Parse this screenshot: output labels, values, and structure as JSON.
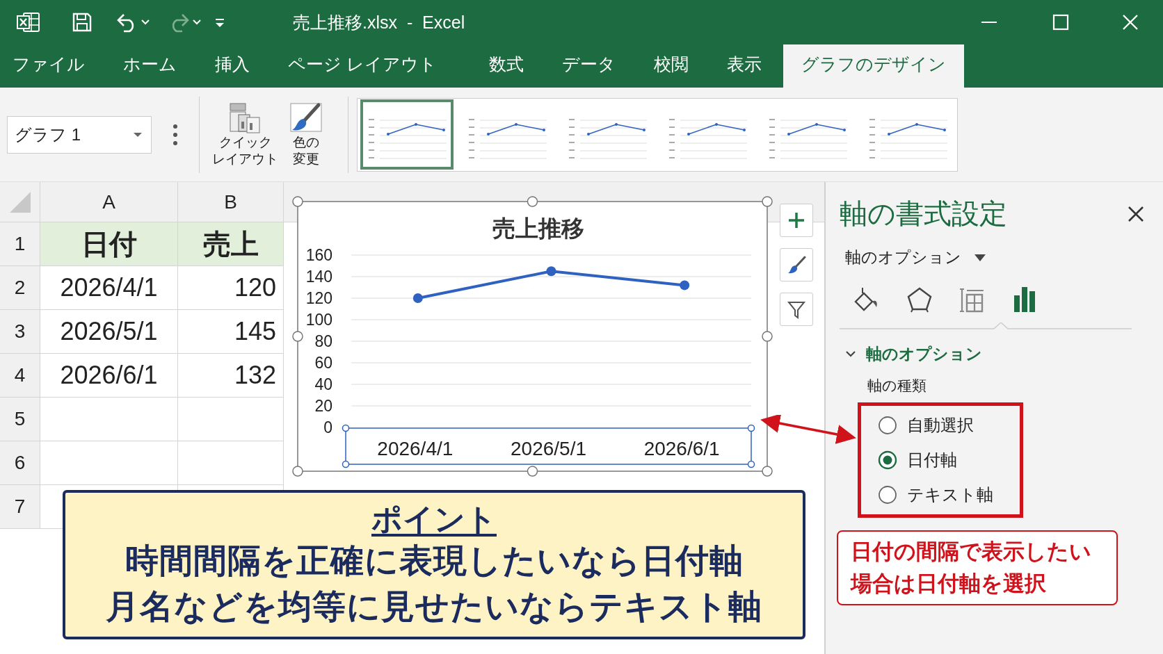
{
  "window": {
    "title": "売上推移.xlsx  -  Excel"
  },
  "ribbon_tabs": [
    {
      "label": "ファイル",
      "selected": false
    },
    {
      "label": "ホーム",
      "selected": false
    },
    {
      "label": "挿入",
      "selected": false
    },
    {
      "label": "ページ レイアウト",
      "selected": false
    },
    {
      "label": "数式",
      "selected": false
    },
    {
      "label": "データ",
      "selected": false
    },
    {
      "label": "校閲",
      "selected": false
    },
    {
      "label": "表示",
      "selected": false
    },
    {
      "label": "グラフのデザイン",
      "selected": true
    }
  ],
  "ribbon": {
    "name_box": "グラフ 1",
    "buttons": [
      {
        "kind": "layout",
        "lines": [
          "クイック",
          "レイアウト"
        ]
      },
      {
        "kind": "color",
        "lines": [
          "色の",
          "変更"
        ]
      }
    ]
  },
  "chart_styles": [
    {
      "selected": true
    },
    {
      "selected": false
    },
    {
      "selected": false
    },
    {
      "selected": false
    },
    {
      "selected": false
    },
    {
      "selected": false
    }
  ],
  "sheet": {
    "columns": [
      "A",
      "B"
    ],
    "rows": [
      {
        "number": "1",
        "kind": "header",
        "cells": [
          "日付",
          "売上"
        ]
      },
      {
        "number": "2",
        "kind": "data",
        "cells": [
          "2026/4/1",
          "120"
        ]
      },
      {
        "number": "3",
        "kind": "data",
        "cells": [
          "2026/5/1",
          "145"
        ]
      },
      {
        "number": "4",
        "kind": "data",
        "cells": [
          "2026/6/1",
          "132"
        ]
      },
      {
        "number": "5",
        "kind": "data"
      },
      {
        "number": "6",
        "kind": "data"
      },
      {
        "number": "7",
        "kind": "data"
      }
    ]
  },
  "chart": {
    "chart_data": {
      "type": "line",
      "title": "売上推移",
      "categories": [
        "2026/4/1",
        "2026/5/1",
        "2026/6/1"
      ],
      "series": [
        {
          "color": "#2f62c0",
          "marker": true,
          "values": [
            120,
            145,
            132
          ]
        }
      ],
      "grid": true,
      "ylim": [
        0,
        160
      ],
      "yticks": [
        0,
        20,
        40,
        60,
        80,
        100,
        120,
        140,
        160
      ]
    }
  },
  "panel": {
    "title": "軸の書式設定",
    "options_dropdown": "軸のオプション",
    "icon_tabs": [
      {
        "kind": "fill",
        "selected": false
      },
      {
        "kind": "effects",
        "selected": false
      },
      {
        "kind": "size",
        "selected": false
      },
      {
        "kind": "axis",
        "selected": true
      }
    ],
    "section": {
      "label": "軸のオプション",
      "expanded": true
    },
    "field_label": "軸の種類",
    "axis_types": [
      {
        "label": "自動選択",
        "selected": false
      },
      {
        "label": "日付軸",
        "selected": true
      },
      {
        "label": "テキスト軸",
        "selected": false
      }
    ],
    "note": "日付の間隔で表示したい場合は日付軸を選択"
  },
  "point_box": {
    "heading": "ポイント",
    "lines": [
      "時間間隔を正確に表現したいなら日付軸",
      "月名などを均等に見せたいならテキスト軸"
    ]
  }
}
